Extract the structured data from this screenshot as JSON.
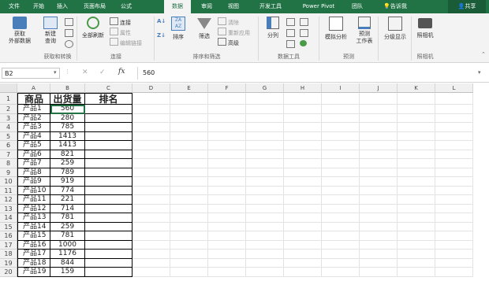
{
  "tabs": [
    {
      "label": "文件",
      "active": false
    },
    {
      "label": "开始",
      "active": false
    },
    {
      "label": "插入",
      "active": false
    },
    {
      "label": "页面布局",
      "active": false
    },
    {
      "label": "公式",
      "active": false
    },
    {
      "label": "数据",
      "active": true
    },
    {
      "label": "审阅",
      "active": false
    },
    {
      "label": "视图",
      "active": false
    },
    {
      "label": "开发工具",
      "active": false
    },
    {
      "label": "Power Pivot",
      "active": false
    },
    {
      "label": "团队",
      "active": false
    }
  ],
  "tell_me": "告诉我",
  "share": "共享",
  "ribbon": {
    "get_external": "获取\n外部数据",
    "new_query": "新建\n查询",
    "refresh_all": "全部刷新",
    "connections": "连接",
    "properties": "属性",
    "edit_links": "编辑链接",
    "sort": "排序",
    "filter": "筛选",
    "clear": "清除",
    "reapply": "重新应用",
    "advanced": "高级",
    "text_to_columns": "分列",
    "what_if": "模拟分析",
    "forecast_sheet": "预测\n工作表",
    "outline": "分级显示",
    "camera": "照相机",
    "groups": {
      "get_transform": "获取和转换",
      "connections": "连接",
      "sort_filter": "排序和筛选",
      "data_tools": "数据工具",
      "forecast": "预测",
      "camera": "照相机"
    }
  },
  "formula_bar": {
    "name_box": "B2",
    "fx": "fx",
    "value": "560"
  },
  "columns": [
    "A",
    "B",
    "C",
    "D",
    "E",
    "F",
    "G",
    "H",
    "I",
    "J",
    "K",
    "L"
  ],
  "table": {
    "headers": [
      "商品",
      "出货量",
      "排名"
    ],
    "rows": [
      [
        "产品1",
        "560"
      ],
      [
        "产品2",
        "280"
      ],
      [
        "产品3",
        "785"
      ],
      [
        "产品4",
        "1413"
      ],
      [
        "产品5",
        "1413"
      ],
      [
        "产品6",
        "821"
      ],
      [
        "产品7",
        "259"
      ],
      [
        "产品8",
        "789"
      ],
      [
        "产品9",
        "919"
      ],
      [
        "产品10",
        "774"
      ],
      [
        "产品11",
        "221"
      ],
      [
        "产品12",
        "714"
      ],
      [
        "产品13",
        "781"
      ],
      [
        "产品14",
        "259"
      ],
      [
        "产品15",
        "781"
      ],
      [
        "产品16",
        "1000"
      ],
      [
        "产品17",
        "1176"
      ],
      [
        "产品18",
        "844"
      ],
      [
        "产品19",
        "159"
      ]
    ]
  },
  "colors": {
    "accent": "#217346"
  }
}
